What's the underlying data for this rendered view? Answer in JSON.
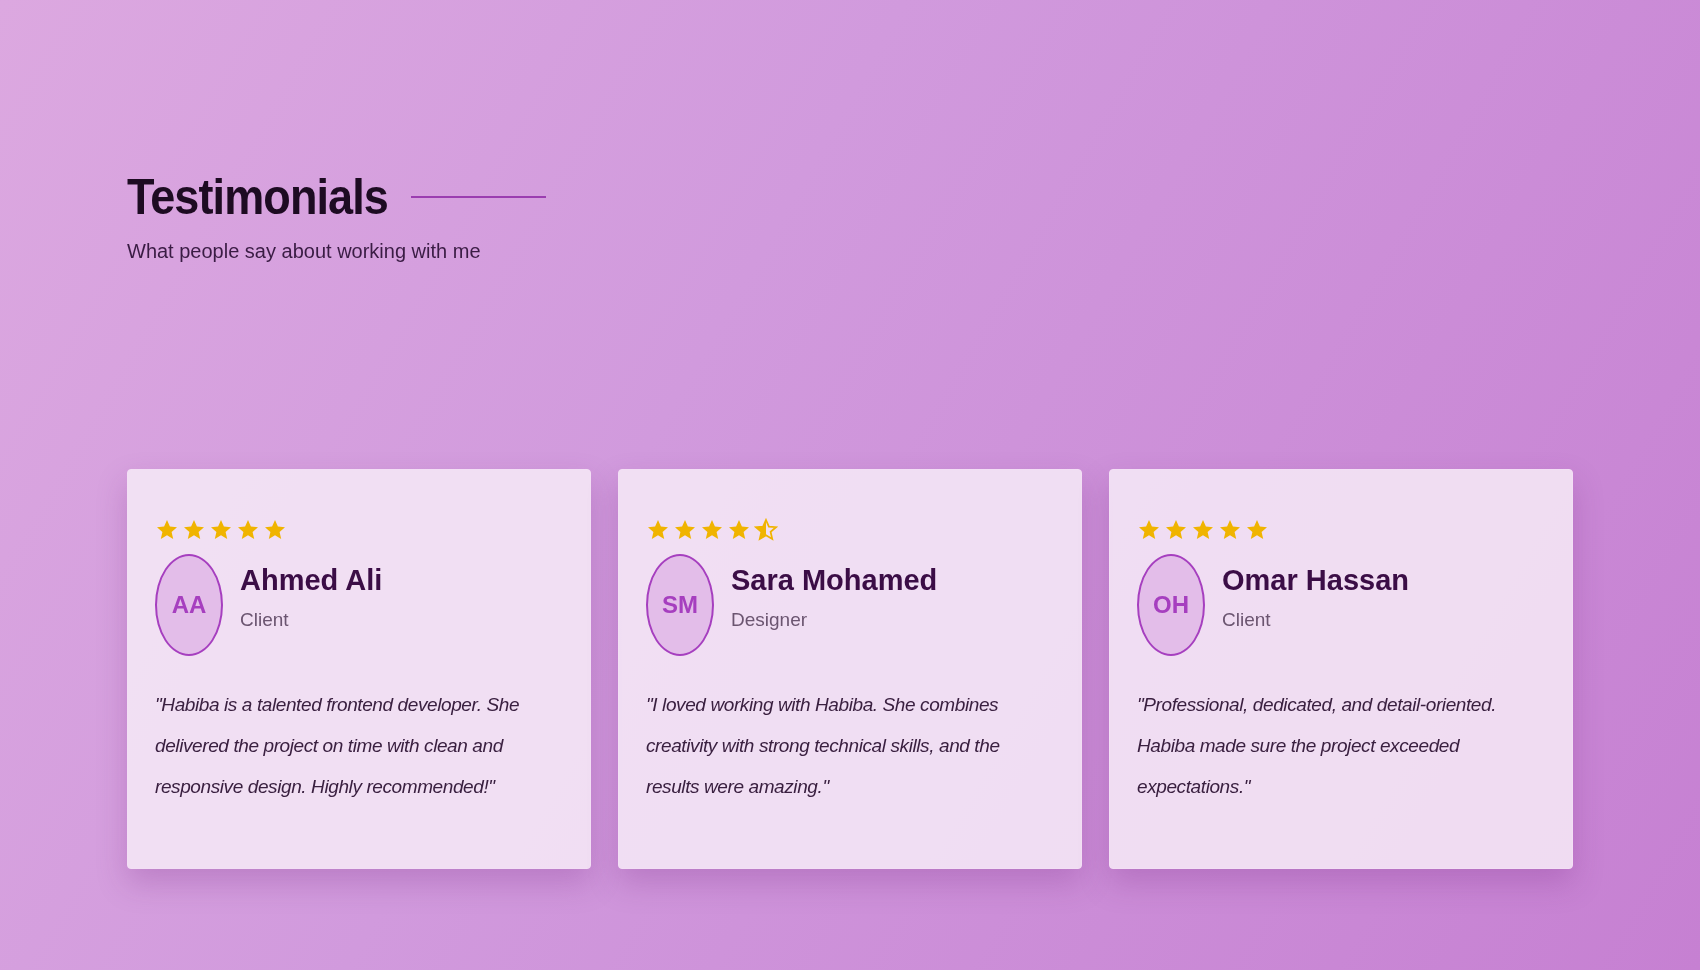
{
  "header": {
    "title": "Testimonials",
    "subtitle": "What people say about working with me"
  },
  "testimonials": [
    {
      "stars": 5,
      "initials": "AA",
      "name": "Ahmed Ali",
      "role": "Client",
      "quote": "\"Habiba is a talented frontend developer. She delivered the project on time with clean and responsive design. Highly recommended!\""
    },
    {
      "stars": 4.5,
      "initials": "SM",
      "name": "Sara Mohamed",
      "role": "Designer",
      "quote": "\"I loved working with Habiba. She combines creativity with strong technical skills, and the results were amazing.\""
    },
    {
      "stars": 5,
      "initials": "OH",
      "name": "Omar Hassan",
      "role": "Client",
      "quote": "\"Professional, dedicated, and detail-oriented. Habiba made sure the project exceeded expectations.\""
    }
  ]
}
